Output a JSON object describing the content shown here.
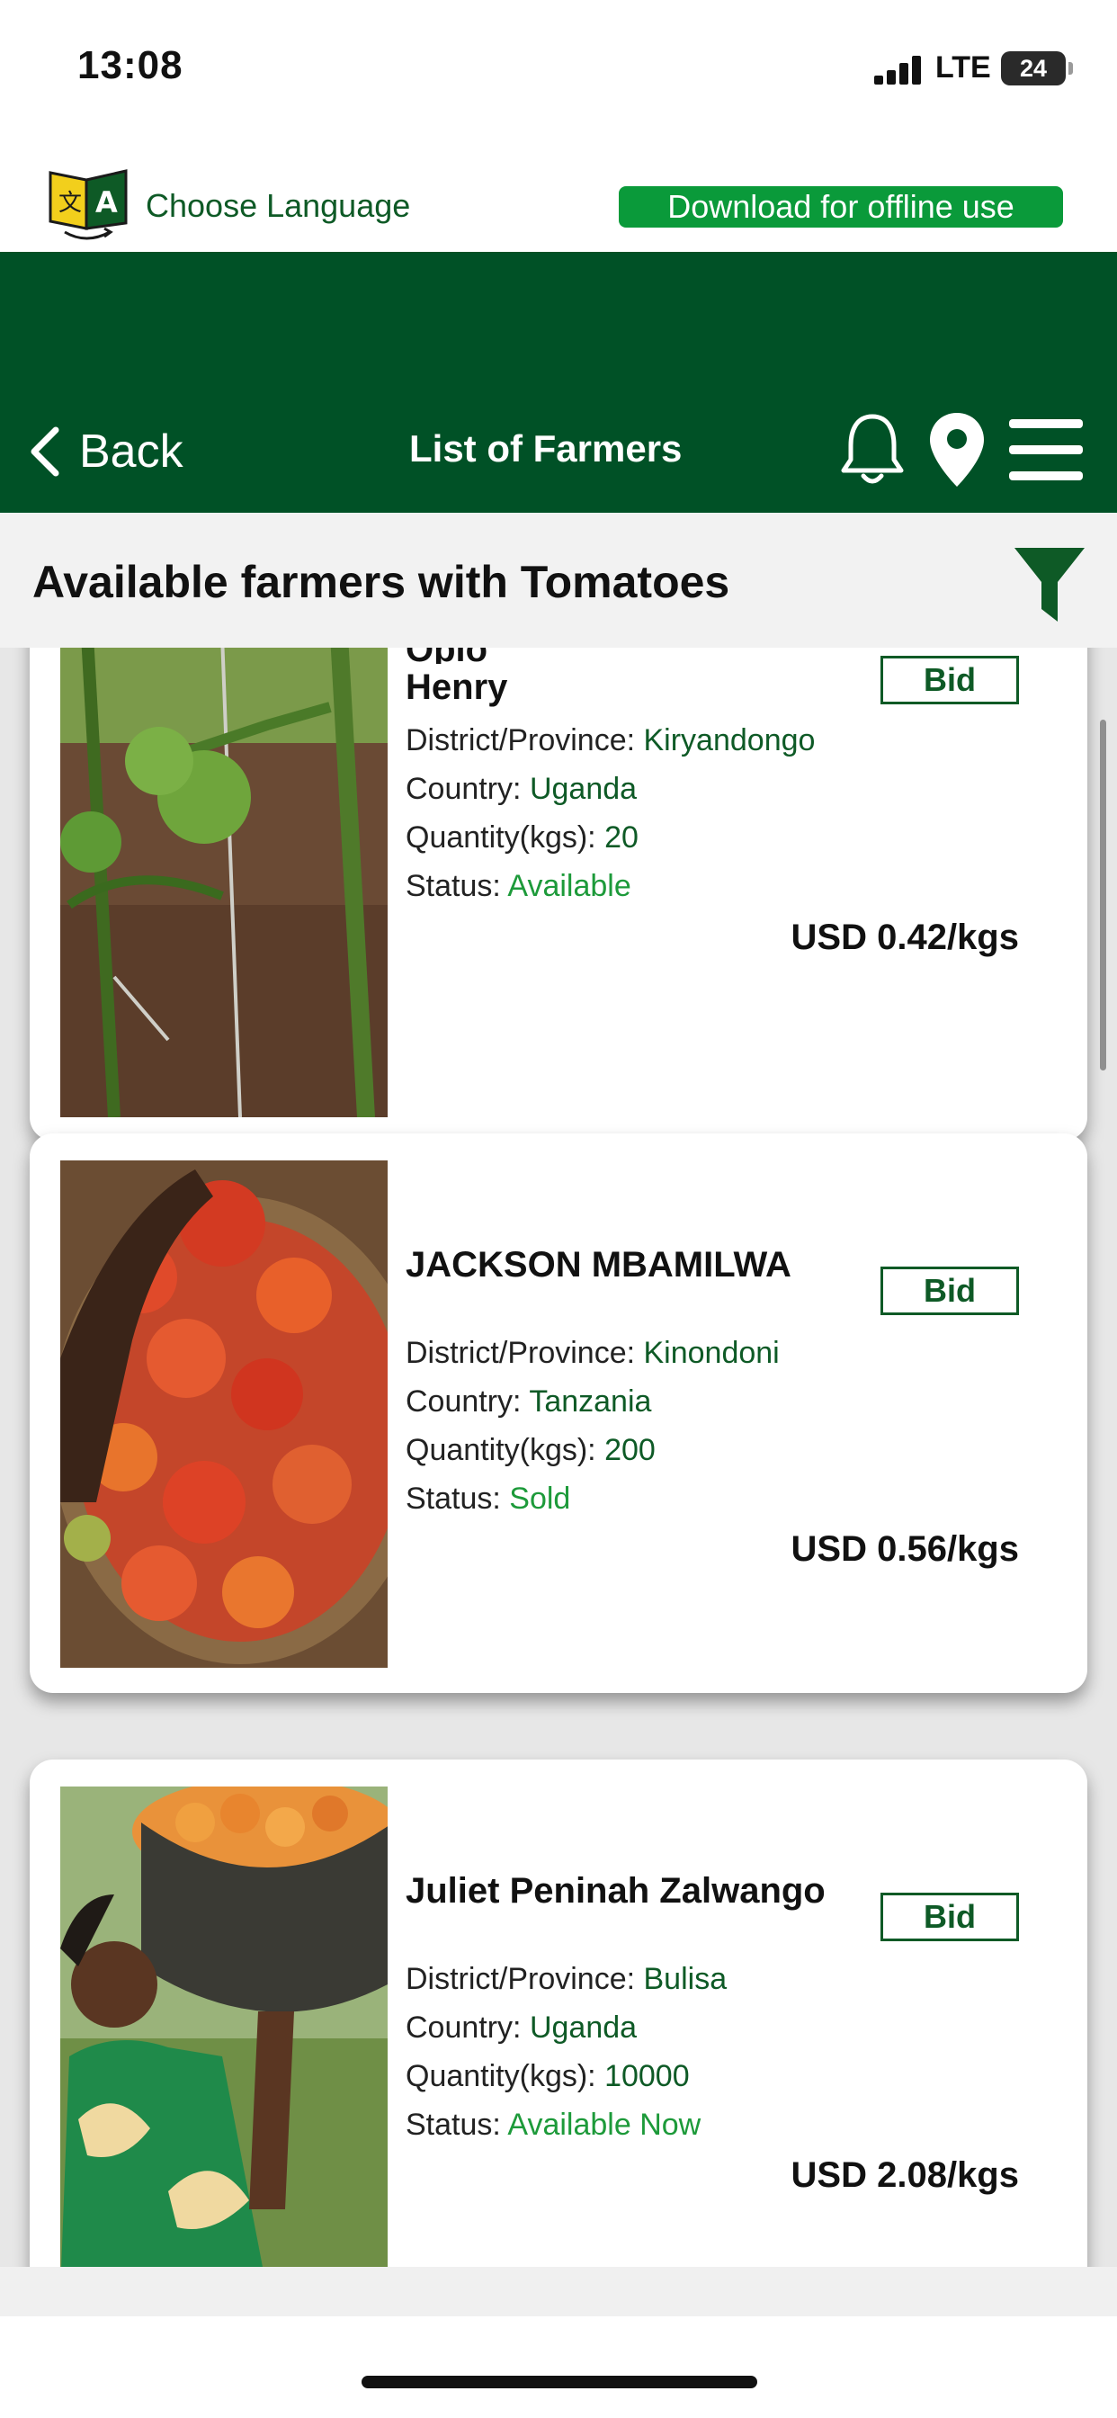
{
  "status_bar": {
    "time": "13:08",
    "network": "LTE",
    "battery": "24"
  },
  "language": {
    "label": "Choose Language",
    "offline_button": "Download for offline use"
  },
  "header": {
    "back_label": "Back",
    "title": "List of Farmers"
  },
  "subheader": {
    "title": "Available farmers with Tomatoes"
  },
  "labels": {
    "district": "District/Province: ",
    "country": "Country: ",
    "quantity": "Quantity(kgs): ",
    "status": "Status: ",
    "bid": "Bid"
  },
  "farmers": [
    {
      "name_top": "Oplo",
      "name": "Henry",
      "district": "Kiryandongo",
      "country": "Uganda",
      "quantity": "20",
      "status": "Available",
      "price": "USD 0.42/kgs",
      "photo": "green-tomatoes-on-vine"
    },
    {
      "name": "JACKSON MBAMILWA",
      "district": "Kinondoni",
      "country": "Tanzania",
      "quantity": "200",
      "status": "Sold",
      "price": "USD 0.56/kgs",
      "photo": "basket-of-tomatoes"
    },
    {
      "name": "Juliet Peninah Zalwango",
      "district": "Bulisa",
      "country": "Uganda",
      "quantity": "10000",
      "status": "Available Now",
      "price": "USD 2.08/kgs",
      "photo": "woman-carrying-tomatoes"
    }
  ],
  "colors": {
    "header_green": "#005126",
    "value_green": "#0e5a26",
    "status_green": "#1d9a3a",
    "offline_button": "#0a9a3a"
  }
}
